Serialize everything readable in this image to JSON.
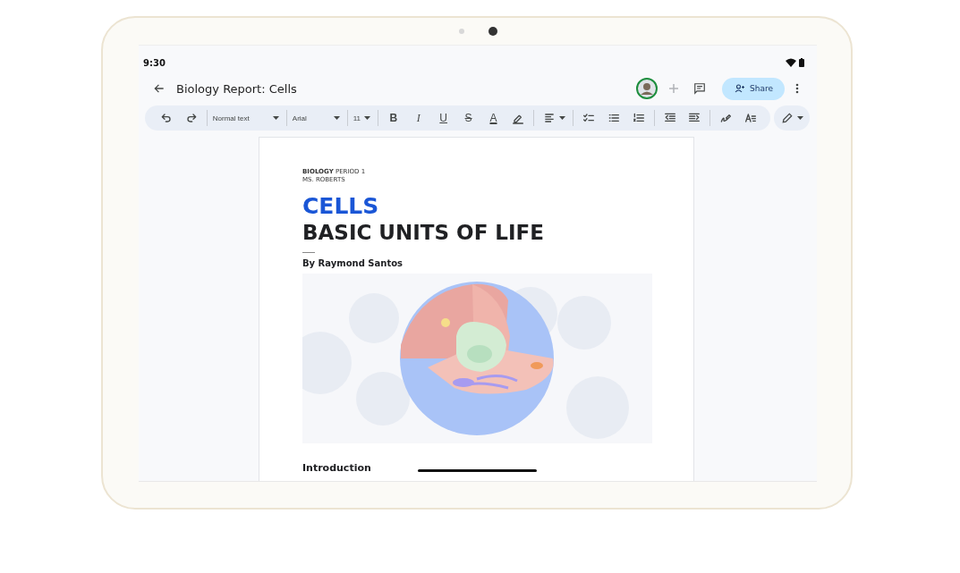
{
  "status_bar": {
    "time": "9:30"
  },
  "app_bar": {
    "title": "Biology Report: Cells",
    "share_button": "Share"
  },
  "toolbar": {
    "dropdowns": [
      {
        "kind": "style",
        "value": "Normal text"
      },
      {
        "kind": "font",
        "value": "Arial"
      },
      {
        "kind": "size",
        "value": "11"
      }
    ],
    "format_buttons": [
      {
        "kind": "bold",
        "label": "B"
      },
      {
        "kind": "italic",
        "label": "I"
      },
      {
        "kind": "underline",
        "label": "U"
      },
      {
        "kind": "strike",
        "label": "S"
      },
      {
        "kind": "color",
        "label": "A"
      }
    ]
  },
  "document": {
    "header_lines": [
      "**BIOLOGY** PERIOD 1",
      "MS. ROBERTS"
    ],
    "title": "CELLS",
    "subtitle": "BASIC UNITS OF LIFE",
    "author": "By Raymond Santos",
    "heading": "Introduction"
  }
}
